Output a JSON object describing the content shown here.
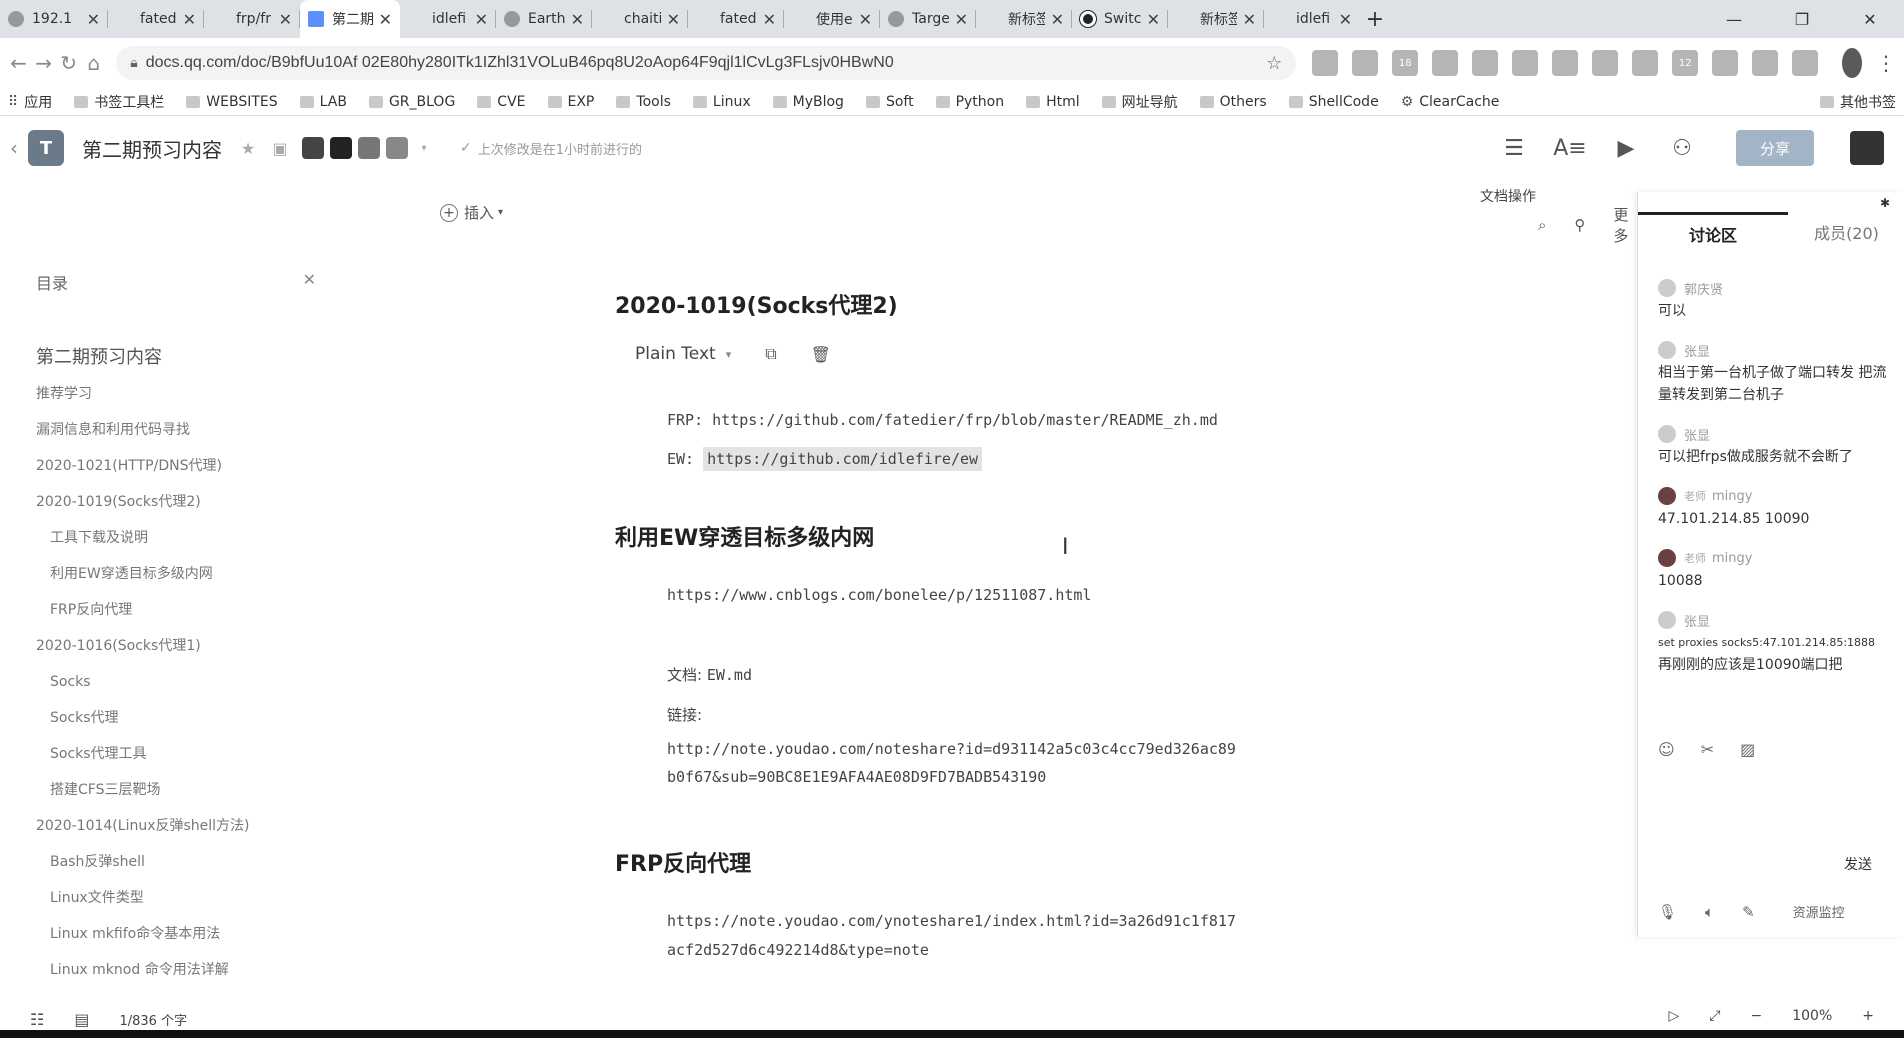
{
  "browser": {
    "tabs": [
      {
        "label": "192.1",
        "favicon": "globe-icon"
      },
      {
        "label": "fated",
        "favicon": "blank"
      },
      {
        "label": "frp/fr",
        "favicon": "blank"
      },
      {
        "label": "第二期",
        "favicon": "doc-icon",
        "active": true
      },
      {
        "label": "idlefi",
        "favicon": "blank"
      },
      {
        "label": "Earth",
        "favicon": "earth-icon"
      },
      {
        "label": "chaiti",
        "favicon": "blank"
      },
      {
        "label": "fated",
        "favicon": "blank"
      },
      {
        "label": "使用e",
        "favicon": "blank"
      },
      {
        "label": "Targe",
        "favicon": "globe-icon"
      },
      {
        "label": "新标签页",
        "favicon": "blank"
      },
      {
        "label": "Switc",
        "favicon": "github-icon"
      },
      {
        "label": "新标签页",
        "favicon": "blank"
      },
      {
        "label": "idlefi",
        "favicon": "blank"
      }
    ],
    "url": "docs.qq.com/doc/B9bfUu10Af 02E80hy280ITk1IZhl31VOLuB46pq8U2oAop64F9qjl1lCvLg3FLsjv0HBwN0",
    "extension_badges": [
      "",
      "",
      "18",
      "",
      "",
      "",
      "",
      "",
      "",
      "12",
      "",
      "",
      "",
      ""
    ],
    "bookmarks": [
      "应用",
      "书签工具栏",
      "WEBSITES",
      "LAB",
      "GR_BLOG",
      "CVE",
      "EXP",
      "Tools",
      "Linux",
      "MyBlog",
      "Soft",
      "Python",
      "Html",
      "网址导航",
      "Others",
      "ShellCode",
      "ClearCache"
    ],
    "bookmarks_right": "其他书签"
  },
  "doc": {
    "title": "第二期预习内容",
    "save_status": "上次修改是在1小时前进行的",
    "share_label": "分享",
    "insert_label": "插入",
    "doc_ops_label": "文档操作",
    "more_label": "更多"
  },
  "outline": {
    "heading": "目录",
    "items": [
      {
        "label": "第二期预习内容",
        "level": 0
      },
      {
        "label": "推荐学习",
        "level": 1
      },
      {
        "label": "漏洞信息和利用代码寻找",
        "level": 1
      },
      {
        "label": "2020-1021(HTTP/DNS代理)",
        "level": 1
      },
      {
        "label": "2020-1019(Socks代理2)",
        "level": 1
      },
      {
        "label": "工具下载及说明",
        "level": 2
      },
      {
        "label": "利用EW穿透目标多级内网",
        "level": 2
      },
      {
        "label": "FRP反向代理",
        "level": 2
      },
      {
        "label": "2020-1016(Socks代理1)",
        "level": 1
      },
      {
        "label": "Socks",
        "level": 2
      },
      {
        "label": "Socks代理",
        "level": 2
      },
      {
        "label": "Socks代理工具",
        "level": 2
      },
      {
        "label": "搭建CFS三层靶场",
        "level": 2
      },
      {
        "label": "2020-1014(Linux反弹shell方法)",
        "level": 1
      },
      {
        "label": "Bash反弹shell",
        "level": 2
      },
      {
        "label": "Linux文件类型",
        "level": 2
      },
      {
        "label": "Linux mkfifo命令基本用法",
        "level": 2
      },
      {
        "label": "Linux mknod 命令用法详解",
        "level": 2
      }
    ]
  },
  "content": {
    "section1_title": "2020-1019(Socks代理2)",
    "code_lang": "Plain Text",
    "frp_line": "FRP: https://github.com/fatedier/frp/blob/master/README_zh.md",
    "ew_prefix": "EW: ",
    "ew_link": "https://github.com/idlefire/ew",
    "section2_title": "利用EW穿透目标多级内网",
    "cnblogs_link": "https://www.cnblogs.com/bonelee/p/12511087.html",
    "doc_label": "文档:",
    "doc_file": "EW.md",
    "link_label": "链接:",
    "youdao_link_1": "http://note.youdao.com/noteshare?id=d931142a5c03c4cc79ed326ac89",
    "youdao_link_2": "b0f67&sub=90BC8E1E9AFA4AE08D9FD7BADB543190",
    "section3_title": "FRP反向代理",
    "youdao2_link_1": "https://note.youdao.com/ynoteshare1/index.html?id=3a26d91c1f817",
    "youdao2_link_2": "acf2d527d6c492214d8&type=note"
  },
  "panel": {
    "tab_discussion": "讨论区",
    "tab_members": "成员(20)",
    "messages": [
      {
        "author": "郭庆贤",
        "role": "",
        "text": "可以",
        "avatar": "light"
      },
      {
        "author": "张显",
        "role": "",
        "text": "相当于第一台机子做了端口转发 把流",
        "text2": "量转发到第二台机子",
        "avatar": "light"
      },
      {
        "author": "张显",
        "role": "",
        "text": "可以把frps做成服务就不会断了",
        "avatar": "light"
      },
      {
        "author": "mingy",
        "role": "老师",
        "text": "47.101.214.85 10090",
        "avatar": "dark"
      },
      {
        "author": "mingy",
        "role": "老师",
        "text": "10088",
        "avatar": "dark"
      },
      {
        "author": "张显",
        "role": "",
        "text_small": "set proxies socks5:47.101.214.85:1888",
        "text": "再刚刚的应该是10090端口把",
        "avatar": "light"
      }
    ],
    "send_label": "发送",
    "resource_monitor": "资源监控"
  },
  "status": {
    "word_count": "1/836 个字",
    "zoom": "100%"
  }
}
